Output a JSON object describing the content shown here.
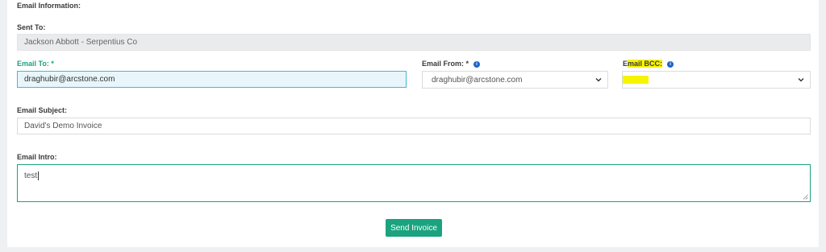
{
  "section_title": "Email Information:",
  "sent_to": {
    "label": "Sent To:",
    "value": "Jackson Abbott - Serpentius Co"
  },
  "email_to": {
    "label": "Email To: *",
    "value": "draghubir@arcstone.com"
  },
  "email_from": {
    "label": "Email From: *",
    "selected": "draghubir@arcstone.com"
  },
  "email_bcc": {
    "label_prefix": "E",
    "label_highlight": "mail BCC:",
    "selected": ""
  },
  "email_subject": {
    "label": "Email Subject:",
    "value": "David's Demo Invoice"
  },
  "email_intro": {
    "label": "Email Intro:",
    "value": "test"
  },
  "send_button": {
    "label": "Send Invoice"
  },
  "colors": {
    "accent": "#1aa37e",
    "highlight": "#f7f400",
    "info": "#1e64c8",
    "focus": "#45b7d8"
  },
  "icons": {
    "info": "info-circle-icon",
    "dropdown": "chevron-down-icon",
    "resize": "resize-grip-icon"
  }
}
